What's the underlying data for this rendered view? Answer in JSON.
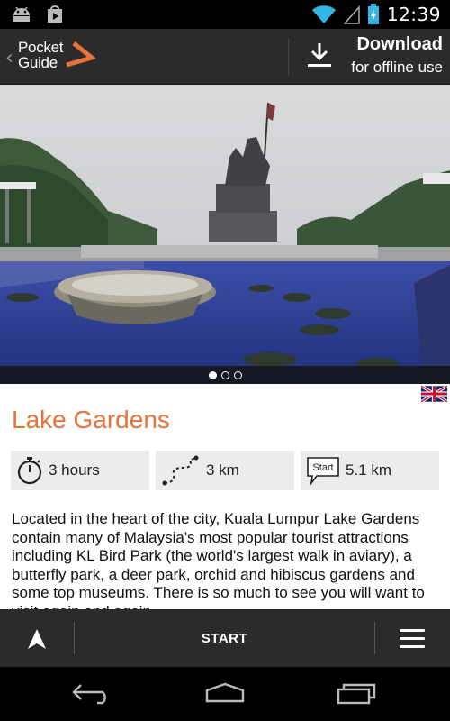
{
  "status_bar": {
    "time": "12:39",
    "left_icons": [
      "android-icon",
      "play-store-icon"
    ],
    "right_icons": [
      "wifi-icon",
      "signal-icon",
      "battery-charging-icon"
    ]
  },
  "header": {
    "logo_line1": "Pocket",
    "logo_line2": "Guide",
    "download_title": "Download",
    "download_subtitle": "for offline use",
    "accent_color": "#e8723a"
  },
  "gallery": {
    "page_count": 3,
    "active_page": 1
  },
  "language_flag": "uk-flag-icon",
  "tour": {
    "title": "Lake Gardens",
    "duration": "3 hours",
    "distance": "3 km",
    "start_badge": "Start",
    "start_distance": "5.1 km",
    "description": "Located in the heart of the city, Kuala Lumpur Lake Gardens contain many of Malaysia's most popular tourist attractions including KL Bird Park (the world's largest walk in aviary), a butterfly park, a deer park, orchid and hibiscus gardens and some top museums. There is so much to see you will want to visit again and again."
  },
  "action_bar": {
    "start_label": "START"
  },
  "system_nav": [
    "back-icon",
    "home-icon",
    "recent-apps-icon"
  ]
}
